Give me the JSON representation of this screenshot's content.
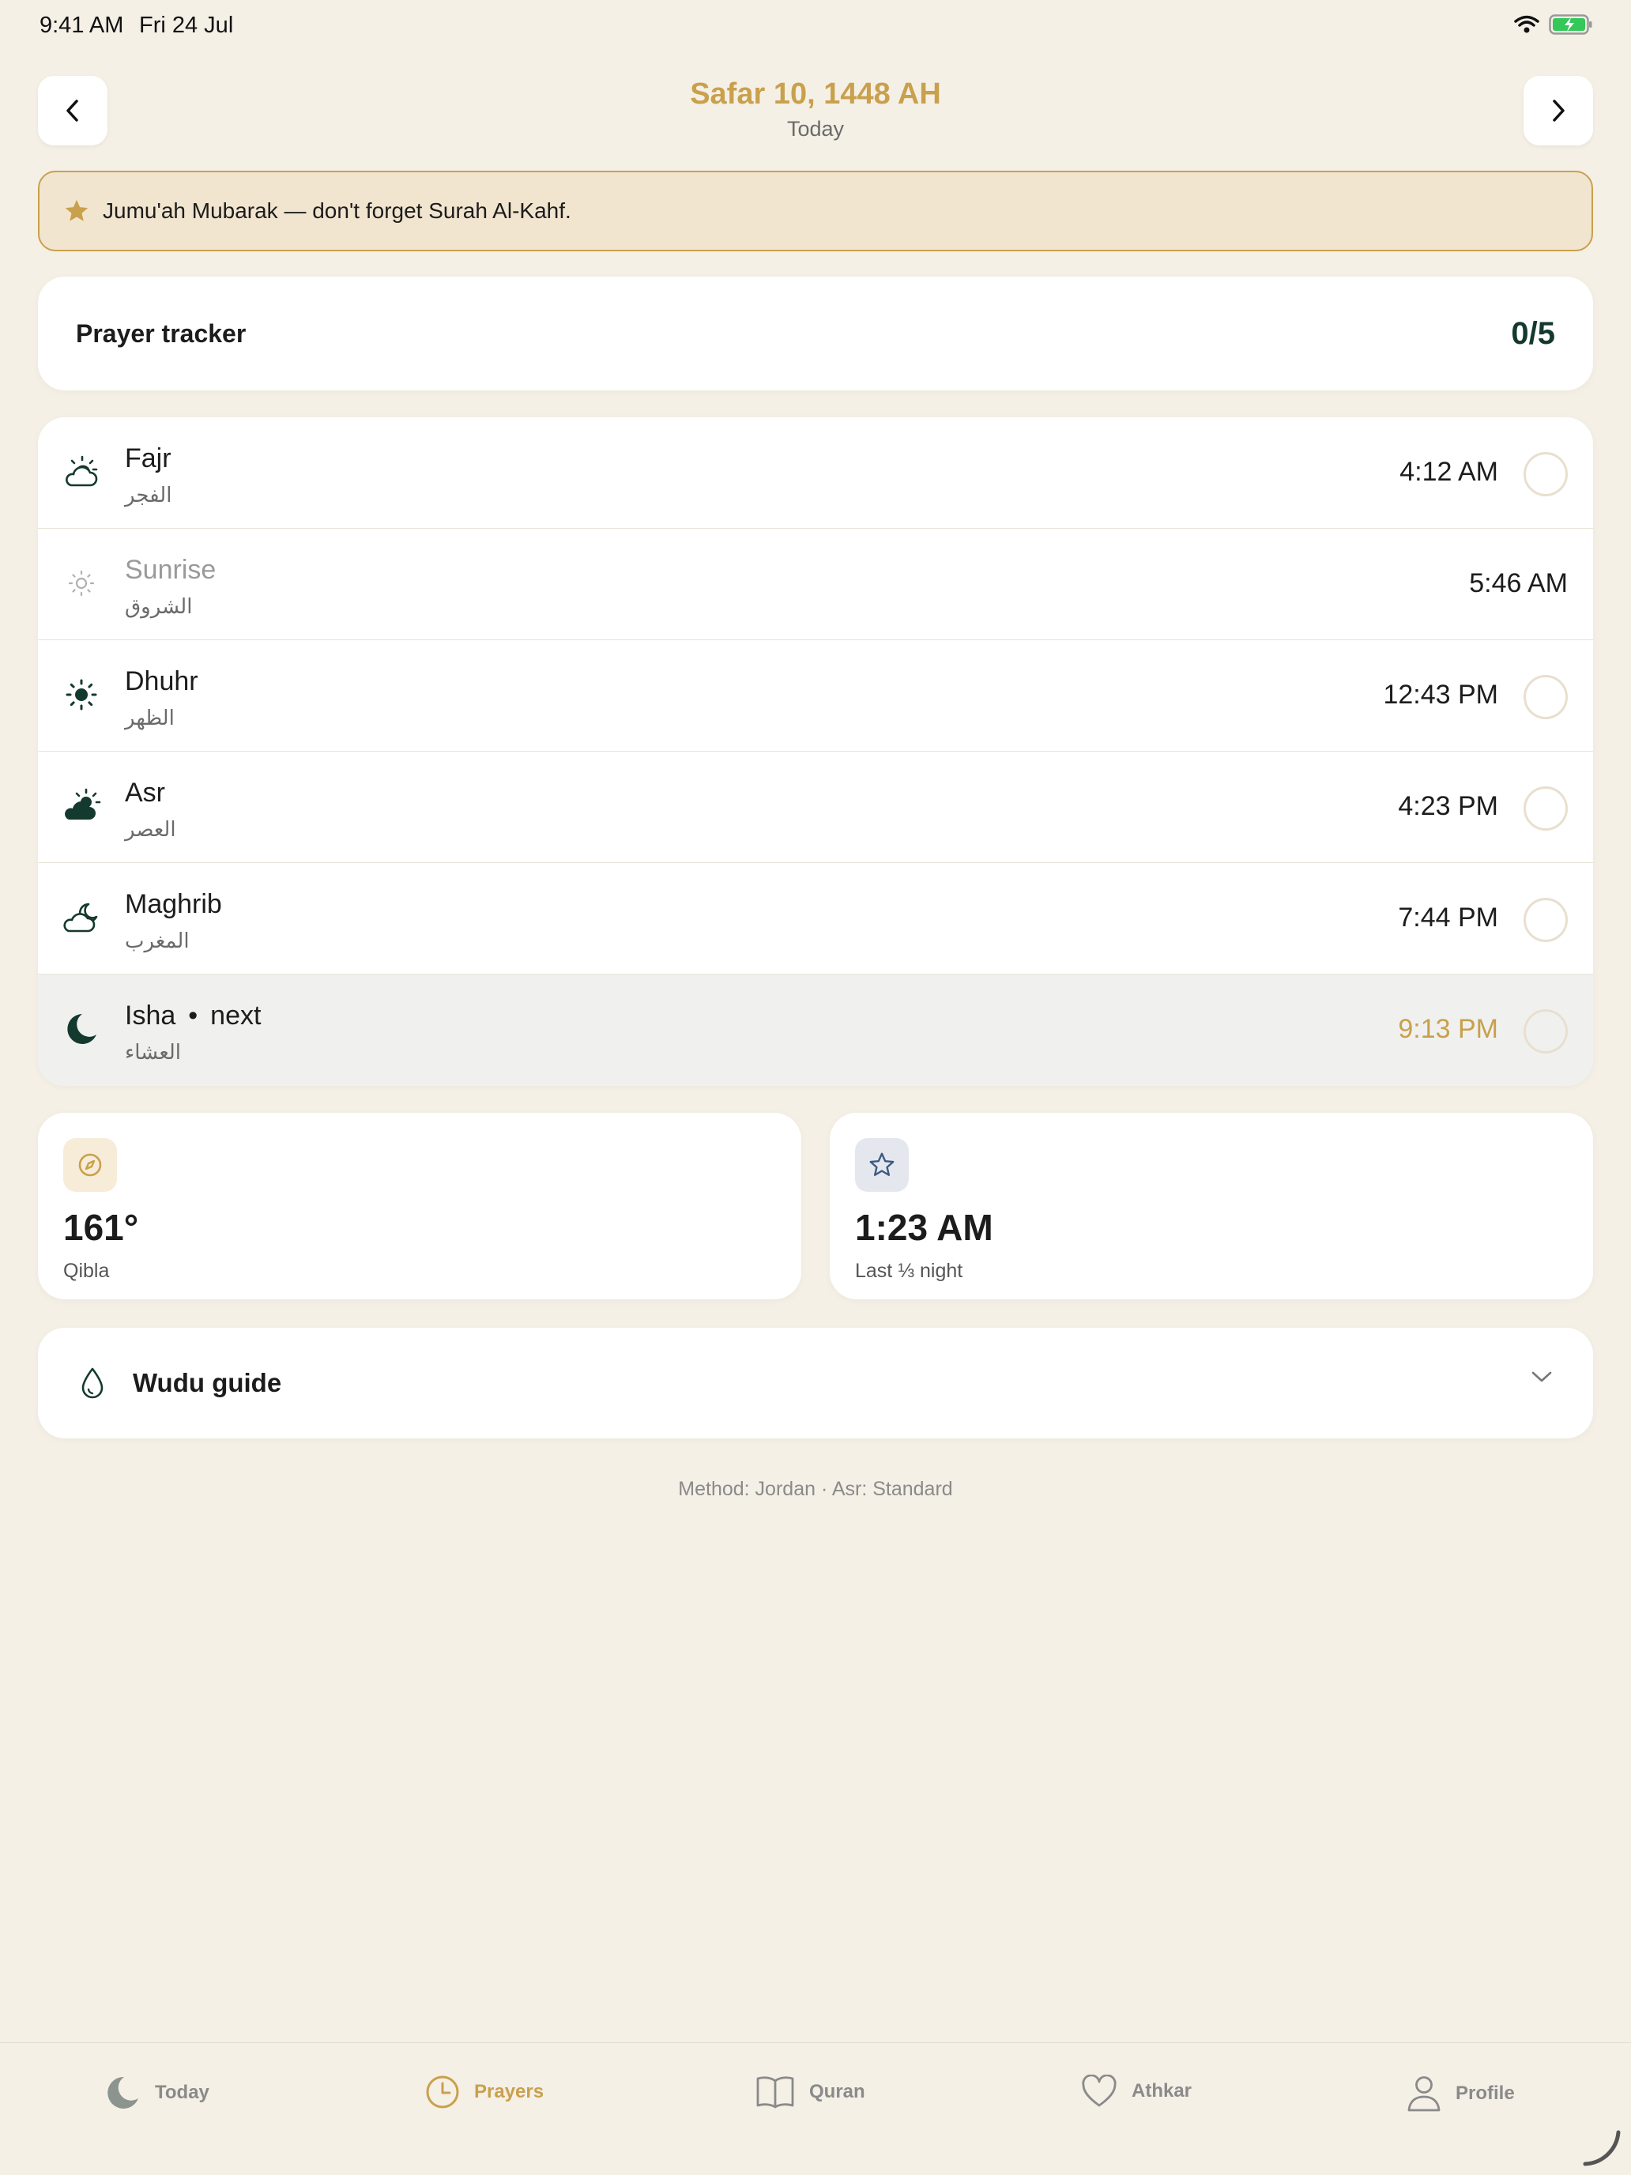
{
  "status_bar": {
    "time": "9:41 AM",
    "date": "Fri 24 Jul"
  },
  "header": {
    "title": "Safar 10, 1448 AH",
    "subtitle": "Today"
  },
  "banner": {
    "text": "Jumu'ah Mubarak — don't forget Surah Al-Kahf."
  },
  "tracker": {
    "label": "Prayer tracker",
    "count": "0/5"
  },
  "prayers": [
    {
      "name": "Fajr",
      "arabic": "الفجر",
      "time": "4:12 AM",
      "icon": "cloud-sun-icon"
    },
    {
      "name": "Sunrise",
      "arabic": "الشروق",
      "time": "5:46 AM",
      "icon": "sunrise-icon"
    },
    {
      "name": "Dhuhr",
      "arabic": "الظهر",
      "time": "12:43 PM",
      "icon": "sun-icon"
    },
    {
      "name": "Asr",
      "arabic": "العصر",
      "time": "4:23 PM",
      "icon": "cloud-sun-filled-icon"
    },
    {
      "name": "Maghrib",
      "arabic": "المغرب",
      "time": "7:44 PM",
      "icon": "cloud-moon-icon"
    },
    {
      "name": "Isha",
      "arabic": "العشاء",
      "time": "9:13 PM",
      "icon": "moon-icon",
      "next_dot": "•",
      "next_label": "next"
    }
  ],
  "qibla": {
    "value": "161°",
    "label": "Qibla"
  },
  "night": {
    "value": "1:23 AM",
    "label": "Last ⅓ night"
  },
  "wudu": {
    "label": "Wudu guide"
  },
  "method": "Method: Jordan · Asr: Standard",
  "tabs": [
    {
      "label": "Today",
      "icon": "moon-icon"
    },
    {
      "label": "Prayers",
      "icon": "clock-icon"
    },
    {
      "label": "Quran",
      "icon": "book-icon"
    },
    {
      "label": "Athkar",
      "icon": "heart-icon"
    },
    {
      "label": "Profile",
      "icon": "person-icon"
    }
  ],
  "colors": {
    "accent": "#c9a04c",
    "dark_green": "#14392f",
    "background": "#f5f0e6"
  }
}
